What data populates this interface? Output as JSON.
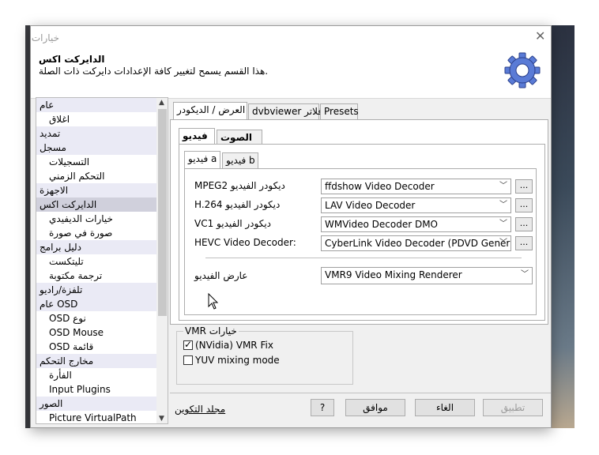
{
  "window": {
    "title": "خيارات"
  },
  "header": {
    "title": "الدايركت اكس",
    "description": "هذا القسم يسمح لتغيير كافة الإعدادات دايركت ذات الصلة."
  },
  "nav": {
    "items": [
      {
        "label": "عام",
        "kind": "section"
      },
      {
        "label": "اغلاق",
        "kind": "sub"
      },
      {
        "label": "تمديد",
        "kind": "section"
      },
      {
        "label": "مسجل",
        "kind": "section"
      },
      {
        "label": "التسجيلات",
        "kind": "sub"
      },
      {
        "label": "التحكم الزمني",
        "kind": "sub"
      },
      {
        "label": "الاجهزة",
        "kind": "section"
      },
      {
        "label": "الدايركت اكس",
        "kind": "section",
        "selected": true
      },
      {
        "label": "خيارات الديفيدي",
        "kind": "sub"
      },
      {
        "label": "صورة في صورة",
        "kind": "sub"
      },
      {
        "label": "دليل برامج",
        "kind": "section"
      },
      {
        "label": "تليتكست",
        "kind": "sub"
      },
      {
        "label": "ترجمة مكتوبة",
        "kind": "sub"
      },
      {
        "label": "تلفزة/راديو",
        "kind": "section"
      },
      {
        "label": "عام OSD",
        "kind": "section"
      },
      {
        "label": "OSD نوع",
        "kind": "sub"
      },
      {
        "label": "OSD Mouse",
        "kind": "sub"
      },
      {
        "label": "OSD قائمة",
        "kind": "sub"
      },
      {
        "label": "مخارج التحكم",
        "kind": "section"
      },
      {
        "label": "الفأرة",
        "kind": "sub"
      },
      {
        "label": "Input Plugins",
        "kind": "sub"
      },
      {
        "label": "الصور",
        "kind": "section"
      },
      {
        "label": "Picture VirtualPath",
        "kind": "sub"
      }
    ]
  },
  "tabs": {
    "display_decoder": "العرض / الديكودر",
    "dvbviewer_filters": "dvbviewer فلاتر",
    "presets": "Presets"
  },
  "subtabs": {
    "video": "فيديو",
    "audio": "الصوت"
  },
  "subsubtabs": {
    "video_a": "فيديو a",
    "video_b": "فيديو b"
  },
  "decoders": [
    {
      "label": "MPEG2 ديكودر الفيديو",
      "value": "ffdshow Video Decoder"
    },
    {
      "label": "H.264 ديكودر الفيديو",
      "value": "LAV Video Decoder"
    },
    {
      "label": "VC1 ديكودر الفيديو",
      "value": "WMVideo Decoder DMO"
    },
    {
      "label": "HEVC Video Decoder:",
      "value": "CyberLink Video Decoder (PDVD Generic)"
    }
  ],
  "dots_label": "...",
  "renderer": {
    "label": "عارض الفيديو",
    "value": "VMR9 Video Mixing Renderer"
  },
  "vmr": {
    "legend": "VMR خيارات",
    "nvidia_fix": {
      "label": "(NVidia) VMR Fix",
      "checked": true
    },
    "yuv_mixing": {
      "label": "YUV mixing mode",
      "checked": false
    }
  },
  "footer": {
    "config_folder": "مجلد التكوين",
    "help": "?",
    "ok": "موافق",
    "cancel": "الغاء",
    "apply": "تطبيق"
  }
}
